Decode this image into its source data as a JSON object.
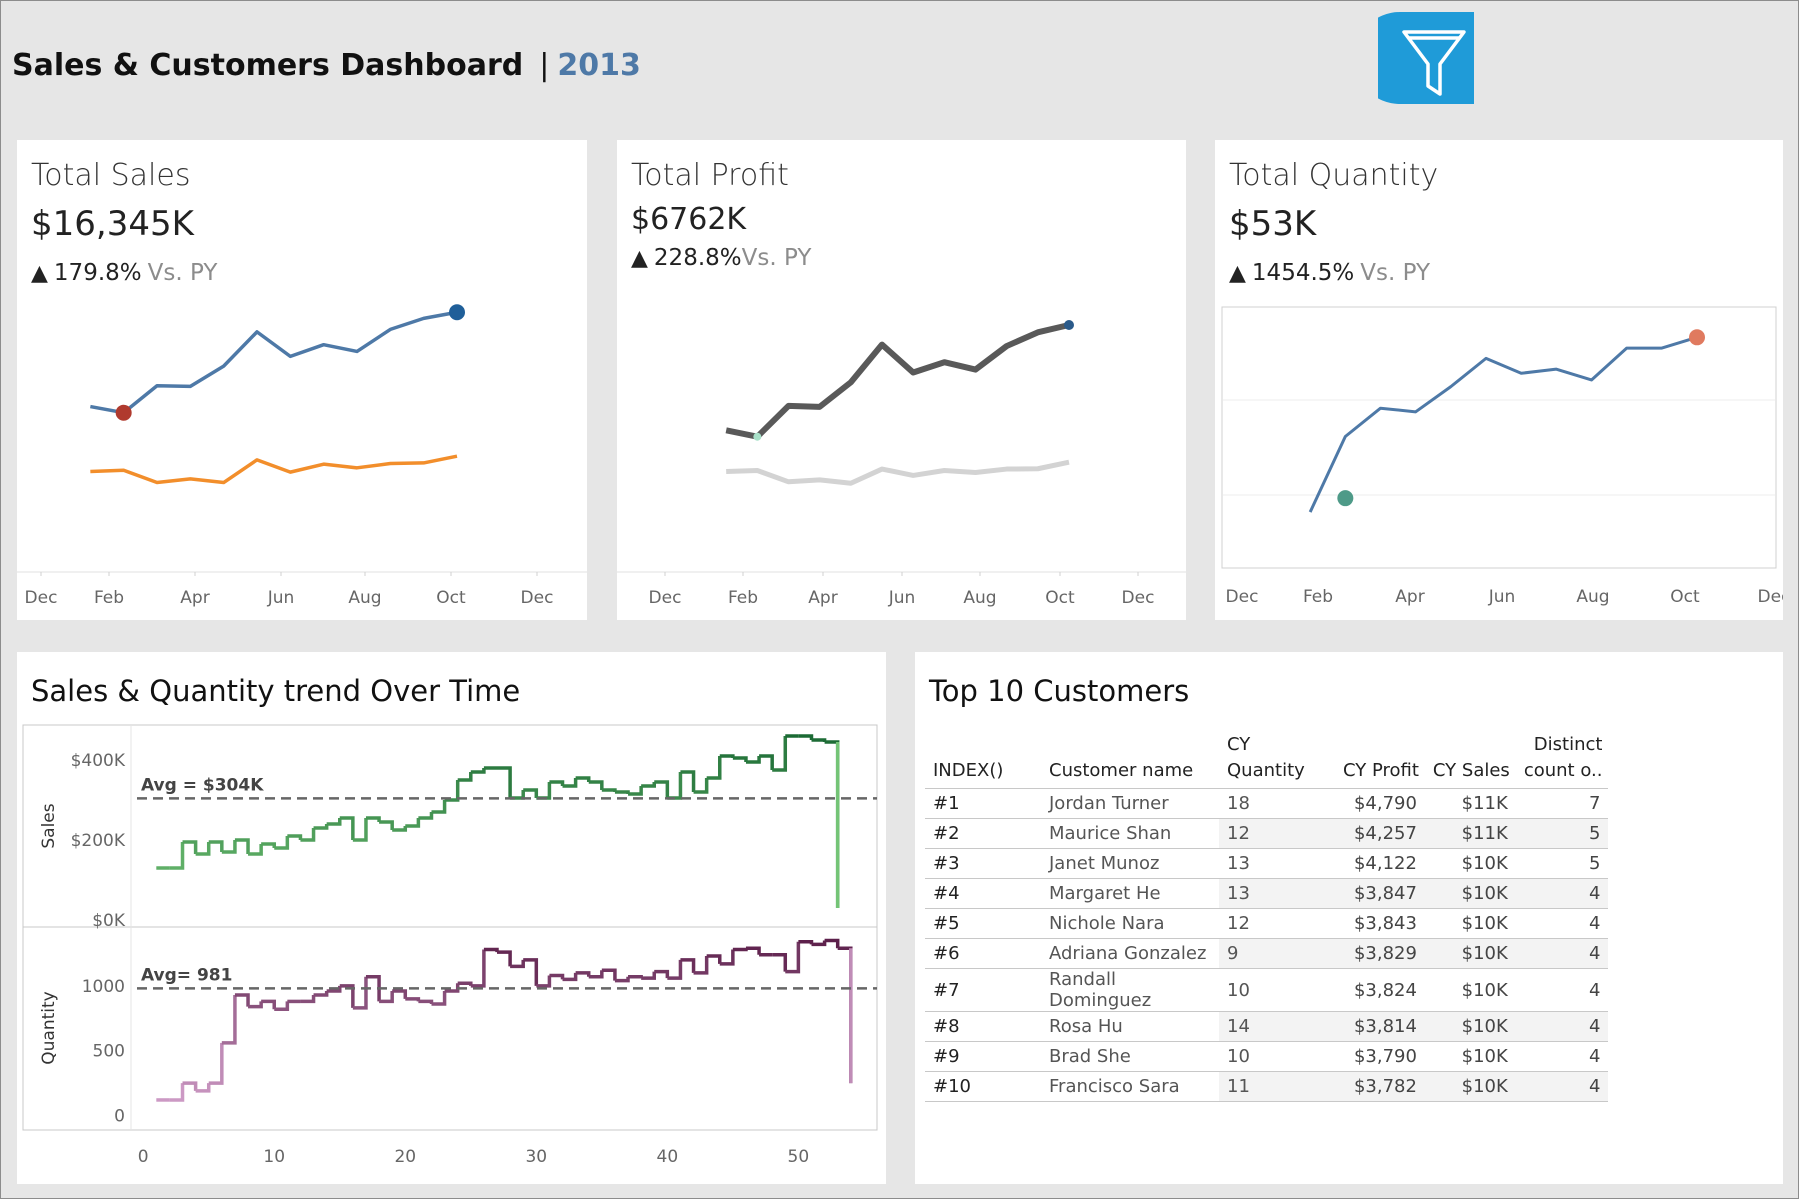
{
  "header": {
    "title": "Sales & Customers Dashboard",
    "separator": "|",
    "year": "2013"
  },
  "filter_button": {
    "icon": "funnel-filter-icon",
    "color": "#1f9bd8"
  },
  "kpis": [
    {
      "title": "Total Sales",
      "value": "$16,345K",
      "delta": "179.8%",
      "vs": "Vs. PY",
      "chart_data": {
        "type": "line",
        "x": [
          "Dec",
          "Jan",
          "Feb",
          "Mar",
          "Apr",
          "May",
          "Jun",
          "Jul",
          "Aug",
          "Sep",
          "Oct",
          "Nov",
          "Dec"
        ],
        "x_tick_labels": [
          "Dec",
          "Feb",
          "Apr",
          "Jun",
          "Aug",
          "Oct",
          "Dec"
        ],
        "series": [
          {
            "values": [
              1130,
              1080,
              1300,
              1295,
              1460,
              1740,
              1540,
              1635,
              1580,
              1760,
              1850,
              1900
            ],
            "color": "#4e79a7",
            "start_index": 1
          },
          {
            "values": [
              600,
              610,
              510,
              540,
              510,
              695,
              595,
              660,
              630,
              665,
              670,
              725
            ],
            "color": "#f28e2b",
            "start_index": 1
          }
        ],
        "markers": [
          {
            "index": 2,
            "series": 0,
            "color": "#b03a2e"
          },
          {
            "index": 12,
            "series": 0,
            "color": "#1f5f99"
          }
        ],
        "ylim": [
          0,
          2000
        ],
        "grid": false
      }
    },
    {
      "title": "Total Profit",
      "value": "$6762K",
      "delta": "228.8%",
      "vs": "Vs. PY",
      "chart_data": {
        "type": "line",
        "x": [
          "Dec",
          "Jan",
          "Feb",
          "Mar",
          "Apr",
          "May",
          "Jun",
          "Jul",
          "Aug",
          "Sep",
          "Oct",
          "Nov",
          "Dec"
        ],
        "x_tick_labels": [
          "Dec",
          "Feb",
          "Apr",
          "Jun",
          "Aug",
          "Oct",
          "Dec"
        ],
        "series": [
          {
            "values": [
              1170,
              1105,
              1420,
              1410,
              1660,
              2045,
              1760,
              1865,
              1790,
              2030,
              2170,
              2245
            ],
            "color": "#595959",
            "start_index": 1
          },
          {
            "values": [
              750,
              760,
              645,
              665,
              630,
              775,
              710,
              760,
              740,
              775,
              778,
              845
            ],
            "color": "#d3d3d3",
            "start_index": 1
          }
        ],
        "markers": [
          {
            "index": 2,
            "series": 0,
            "color": "#a8e0c8"
          },
          {
            "index": 12,
            "series": 0,
            "color": "#2a5a8a"
          }
        ],
        "ylim": [
          0,
          2500
        ],
        "grid": false
      }
    },
    {
      "title": "Total Quantity",
      "value": "$53K",
      "delta": "1454.5%",
      "vs": "Vs. PY",
      "chart_data": {
        "type": "line",
        "x": [
          "Dec",
          "Jan",
          "Feb",
          "Mar",
          "Apr",
          "May",
          "Jun",
          "Jul",
          "Aug",
          "Sep",
          "Oct",
          "Nov",
          "Dec"
        ],
        "x_tick_labels": [
          "Dec",
          "Feb",
          "Apr",
          "Jun",
          "Aug",
          "Oct",
          "Dec"
        ],
        "series": [
          {
            "values": [
              1030,
              2500,
              3050,
              2980,
              3470,
              4020,
              3730,
              3810,
              3600,
              4220,
              4220,
              4430
            ],
            "color": "#4e79a7",
            "start_index": 1
          }
        ],
        "markers": [
          {
            "index": 2,
            "series": -1,
            "y": 1300,
            "color": "#4e9a88"
          },
          {
            "index": 12,
            "series": 0,
            "color": "#e07a5f"
          }
        ],
        "ylim": [
          0,
          5000
        ],
        "grid": true
      }
    }
  ],
  "trend": {
    "title": "Sales & Quantity trend Over Time",
    "chart_data": {
      "type": "line",
      "x_ticks": [
        0,
        10,
        20,
        30,
        40,
        50
      ],
      "xlim": [
        -2,
        56
      ],
      "x_start": 1,
      "x_step": 1,
      "sales": {
        "ylabel": "Sales",
        "ylim": [
          0,
          470000
        ],
        "ticks": [
          0,
          200000,
          400000
        ],
        "tick_labels": [
          "$0K",
          "$200K",
          "$400K"
        ],
        "avg_label": "Avg = $304K",
        "avg": 304000,
        "colors": {
          "low": "#74c476",
          "high": "#1b6a34"
        },
        "values": [
          130000,
          130000,
          195000,
          165000,
          195000,
          170000,
          200000,
          165000,
          190000,
          180000,
          210000,
          200000,
          230000,
          240000,
          255000,
          200000,
          255000,
          245000,
          225000,
          235000,
          255000,
          270000,
          300000,
          350000,
          370000,
          380000,
          380000,
          305000,
          325000,
          305000,
          345000,
          335000,
          355000,
          345000,
          325000,
          320000,
          315000,
          335000,
          345000,
          305000,
          370000,
          320000,
          355000,
          410000,
          405000,
          395000,
          410000,
          375000,
          460000,
          460000,
          450000,
          445000,
          30000
        ]
      },
      "quantity": {
        "ylabel": "Quantity",
        "ylim": [
          -50,
          1400
        ],
        "ticks": [
          0,
          500,
          1000
        ],
        "tick_labels": [
          "0",
          "500",
          "1000"
        ],
        "avg_label": "Avg= 981",
        "avg": 981,
        "colors": {
          "low": "#cc99c4",
          "high": "#5c1f4a"
        },
        "values": [
          120,
          120,
          250,
          190,
          250,
          560,
          930,
          840,
          880,
          820,
          880,
          880,
          930,
          960,
          1000,
          830,
          1070,
          880,
          960,
          900,
          880,
          860,
          960,
          1020,
          1000,
          1280,
          1260,
          1150,
          1200,
          1000,
          1080,
          1050,
          1100,
          1070,
          1120,
          1040,
          1070,
          1060,
          1110,
          1060,
          1200,
          1100,
          1230,
          1170,
          1280,
          1290,
          1240,
          1240,
          1110,
          1340,
          1320,
          1350,
          1290,
          250
        ]
      }
    }
  },
  "customers": {
    "title": "Top 10  Customers",
    "columns": [
      "INDEX()",
      "Customer name",
      "CY Quantity",
      "CY Profit",
      "CY Sales",
      "Distinct",
      "count o.."
    ],
    "rows": [
      [
        "#1",
        "Jordan Turner",
        "18",
        "$4,790",
        "$11K",
        "7"
      ],
      [
        "#2",
        "Maurice Shan",
        "12",
        "$4,257",
        "$11K",
        "5"
      ],
      [
        "#3",
        "Janet Munoz",
        "13",
        "$4,122",
        "$10K",
        "5"
      ],
      [
        "#4",
        "Margaret He",
        "13",
        "$3,847",
        "$10K",
        "4"
      ],
      [
        "#5",
        "Nichole Nara",
        "12",
        "$3,843",
        "$10K",
        "4"
      ],
      [
        "#6",
        "Adriana Gonzalez",
        "9",
        "$3,829",
        "$10K",
        "4"
      ],
      [
        "#7",
        "Randall Dominguez",
        "10",
        "$3,824",
        "$10K",
        "4"
      ],
      [
        "#8",
        "Rosa Hu",
        "14",
        "$3,814",
        "$10K",
        "4"
      ],
      [
        "#9",
        "Brad She",
        "10",
        "$3,790",
        "$10K",
        "4"
      ],
      [
        "#10",
        "Francisco Sara",
        "11",
        "$3,782",
        "$10K",
        "4"
      ]
    ]
  }
}
